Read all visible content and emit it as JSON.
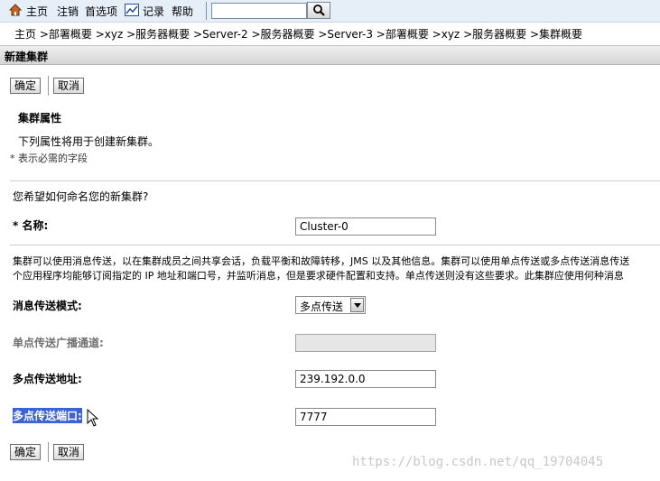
{
  "nav": {
    "home": "主页",
    "logout": "注销",
    "preferences": "首选项",
    "record": "记录",
    "help": "帮助",
    "search_value": ""
  },
  "breadcrumb": {
    "items": [
      "主页",
      ">部署概要",
      ">xyz",
      ">服务器概要",
      ">Server-2",
      ">服务器概要",
      ">Server-3",
      ">部署概要",
      ">xyz",
      ">服务器概要",
      ">集群概要"
    ]
  },
  "page": {
    "title": "新建集群"
  },
  "buttons": {
    "ok": "确定",
    "cancel": "取消"
  },
  "section": {
    "title": "集群属性",
    "desc": "下列属性将用于创建新集群。",
    "required_note": "* 表示必需的字段",
    "question": "您希望如何命名您的新集群?"
  },
  "form": {
    "name_label": "* 名称:",
    "name_value": "Cluster-0",
    "info_line1": "集群可以使用消息传送，以在集群成员之间共享会话，负载平衡和故障转移，JMS 以及其他信息。集群可以使用单点传送或多点传送消息传送",
    "info_line2": "个应用程序均能够订阅指定的 IP 地址和端口号，并监听消息，但是要求硬件配置和支持。单点传送则没有这些要求。此集群应使用何种消息",
    "mode_label": "消息传送模式:",
    "mode_value": "多点传送",
    "unicast_label": "单点传送广播通道:",
    "unicast_value": "",
    "mcast_addr_label": "多点传送地址:",
    "mcast_addr_value": "239.192.0.0",
    "mcast_port_label": "多点传送端口:",
    "mcast_port_value": "7777"
  },
  "watermark": "https://blog.csdn.net/qq_19704045"
}
